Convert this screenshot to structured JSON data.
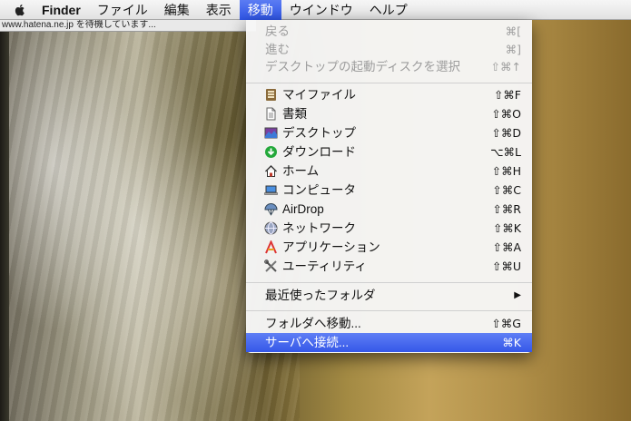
{
  "menubar": {
    "apple_icon": "apple-icon",
    "items": [
      "Finder",
      "ファイル",
      "編集",
      "表示",
      "移動",
      "ウインドウ",
      "ヘルプ"
    ],
    "active": "移動"
  },
  "status_url": "www.hatena.ne.jp を待機しています...",
  "menu": {
    "back": {
      "label": "戻る",
      "shortcut": "⌘["
    },
    "forward": {
      "label": "進む",
      "shortcut": "⌘]"
    },
    "startup_disk": {
      "label": "デスクトップの起動ディスクを選択",
      "shortcut": "⇧⌘↑"
    },
    "items": [
      {
        "label": "マイファイル",
        "shortcut": "⇧⌘F",
        "icon": "my-files-icon"
      },
      {
        "label": "書類",
        "shortcut": "⇧⌘O",
        "icon": "documents-icon"
      },
      {
        "label": "デスクトップ",
        "shortcut": "⇧⌘D",
        "icon": "desktop-icon"
      },
      {
        "label": "ダウンロード",
        "shortcut": "⌥⌘L",
        "icon": "downloads-icon"
      },
      {
        "label": "ホーム",
        "shortcut": "⇧⌘H",
        "icon": "home-icon"
      },
      {
        "label": "コンピュータ",
        "shortcut": "⇧⌘C",
        "icon": "computer-icon"
      },
      {
        "label": "AirDrop",
        "shortcut": "⇧⌘R",
        "icon": "airdrop-icon"
      },
      {
        "label": "ネットワーク",
        "shortcut": "⇧⌘K",
        "icon": "network-icon"
      },
      {
        "label": "アプリケーション",
        "shortcut": "⇧⌘A",
        "icon": "applications-icon"
      },
      {
        "label": "ユーティリティ",
        "shortcut": "⇧⌘U",
        "icon": "utilities-icon"
      }
    ],
    "recent_folders": {
      "label": "最近使ったフォルダ",
      "submenu_arrow": "▶"
    },
    "go_to_folder": {
      "label": "フォルダへ移動...",
      "shortcut": "⇧⌘G"
    },
    "connect_server": {
      "label": "サーバへ接続...",
      "shortcut": "⌘K"
    }
  }
}
